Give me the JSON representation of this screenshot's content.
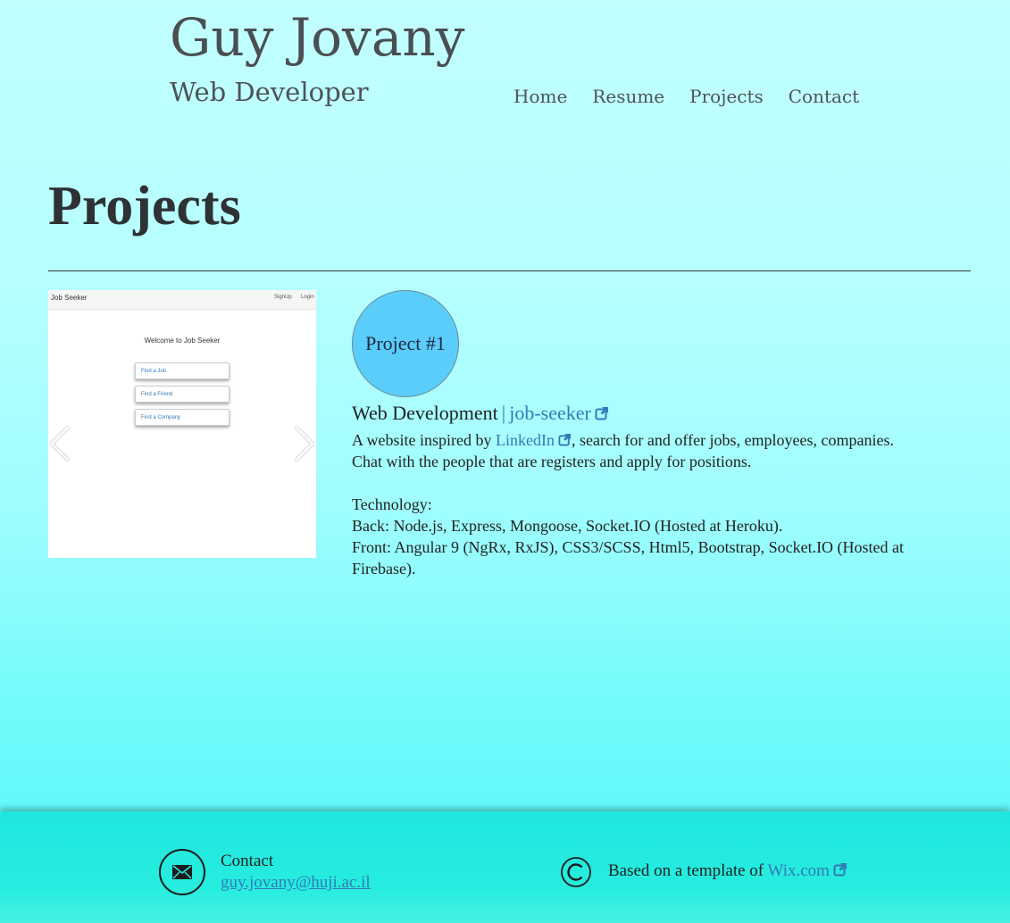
{
  "header": {
    "name": "Guy Jovany",
    "tagline": "Web Developer",
    "nav": [
      "Home",
      "Resume",
      "Projects",
      "Contact"
    ]
  },
  "page": {
    "title": "Projects"
  },
  "carousel": {
    "screenshot": {
      "brand": "Job Seeker",
      "links": [
        "SignUp",
        "Login"
      ],
      "welcome": "Welcome to Job Seeker",
      "buttons": [
        "Find a Job",
        "Find a Friend",
        "Find a Company"
      ]
    }
  },
  "project": {
    "badge": "Project #1",
    "category": "Web Development",
    "separator": "|",
    "link_text": "job-seeker",
    "desc_prefix": "A website inspired by ",
    "desc_link": "LinkedIn",
    "desc_suffix": ", search for and offer jobs, employees, companies.",
    "desc_line2": "Chat with the people that are registers and apply for positions.",
    "tech_label": "Technology:",
    "tech_back": "Back: Node.js, Express, Mongoose, Socket.IO (Hosted at Heroku).",
    "tech_front": "Front: Angular 9 (NgRx, RxJS), CSS3/SCSS, Html5, Bootstrap, Socket.IO (Hosted at Firebase)."
  },
  "footer": {
    "contact_label": "Contact",
    "email": "guy.jovany@huji.ac.il",
    "template_prefix": "Based on a template of ",
    "template_link": "Wix.com"
  },
  "colors": {
    "link": "#337ab7",
    "badge": "#5bcdfb",
    "footer": "#1fe6df"
  }
}
